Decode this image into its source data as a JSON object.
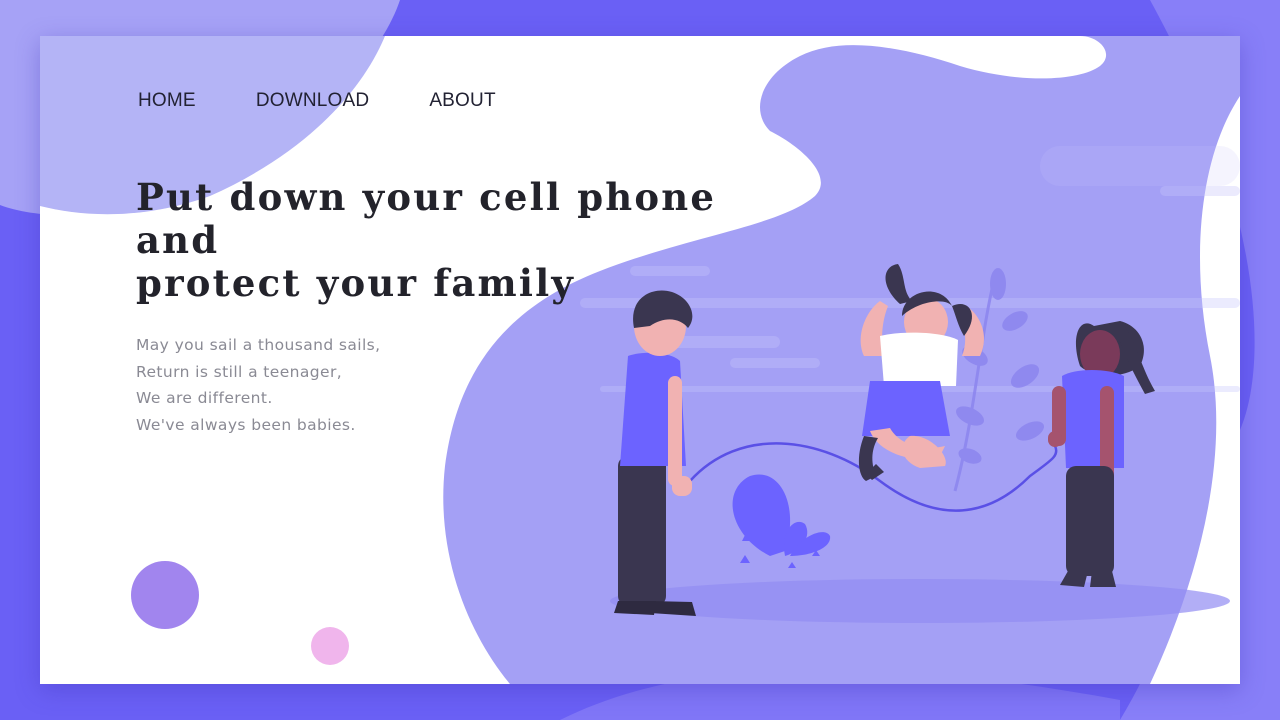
{
  "nav": {
    "items": [
      {
        "label": "HOME"
      },
      {
        "label": "DOWNLOAD"
      },
      {
        "label": "ABOUT"
      }
    ]
  },
  "hero": {
    "headline_lines": [
      "Put down your cell phone and",
      "protect your family"
    ],
    "poem_lines": [
      "May you sail a thousand sails,",
      "Return is still a teenager,",
      "We are different.",
      "We've always been babies."
    ]
  },
  "colors": {
    "page_background": "#6a60f5",
    "blob_light": "#b4b4f6",
    "blob_main": "#a4a0f5",
    "accent_purple": "#a185ee",
    "accent_pink": "#f0b5ec",
    "figure_shirt": "#6c63ff",
    "figure_pants": "#3a3650",
    "skin": "#f1b2b2"
  },
  "illustration": {
    "subject": "children-jumping-rope",
    "icons": [
      "boy-figure",
      "girl-jumping-figure",
      "girl-holding-rope-figure",
      "jump-rope",
      "plant-leaf",
      "branch-plant"
    ]
  }
}
